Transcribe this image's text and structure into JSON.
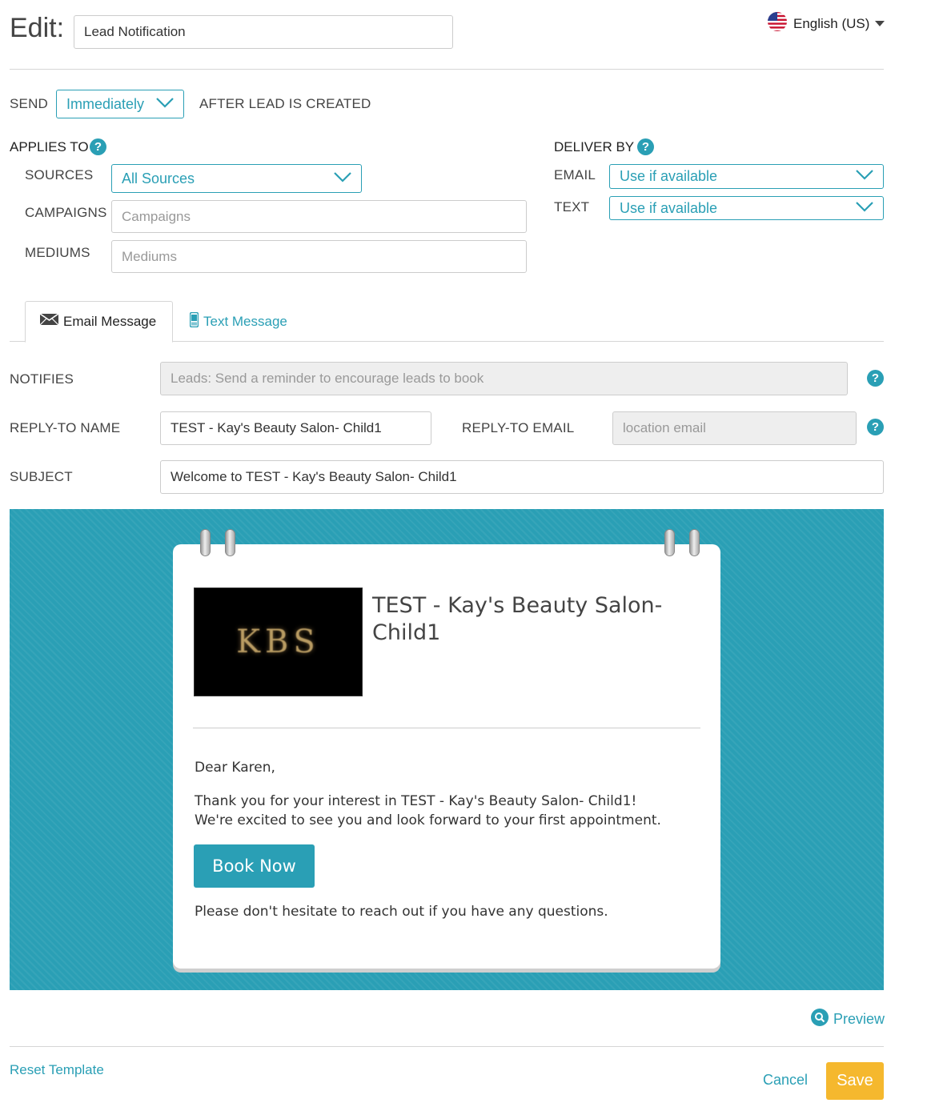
{
  "header": {
    "edit_label": "Edit:",
    "name_value": "Lead Notification",
    "language": "English (US)"
  },
  "send": {
    "label": "SEND",
    "timing": "Immediately",
    "suffix": "AFTER LEAD IS CREATED"
  },
  "applies_to": {
    "label": "APPLIES TO",
    "sources_label": "SOURCES",
    "sources_value": "All Sources",
    "campaigns_label": "CAMPAIGNS",
    "campaigns_placeholder": "Campaigns",
    "mediums_label": "MEDIUMS",
    "mediums_placeholder": "Mediums"
  },
  "deliver_by": {
    "label": "DELIVER BY",
    "email_label": "EMAIL",
    "email_value": "Use if available",
    "text_label": "TEXT",
    "text_value": "Use if available"
  },
  "tabs": [
    {
      "label": "Email Message",
      "active": true
    },
    {
      "label": "Text Message",
      "active": false
    }
  ],
  "form": {
    "notifies_label": "NOTIFIES",
    "notifies_value": "Leads: Send a reminder to encourage leads to book",
    "reply_name_label": "REPLY-TO NAME",
    "reply_name_value": "TEST - Kay's Beauty Salon- Child1",
    "reply_email_label": "REPLY-TO EMAIL",
    "reply_email_placeholder": "location email",
    "subject_label": "SUBJECT",
    "subject_value": "Welcome to TEST - Kay's Beauty Salon- Child1"
  },
  "email_preview": {
    "business_name": "TEST - Kay's Beauty Salon- Child1",
    "logo_text": "KBS",
    "greeting": "Dear Karen,",
    "body_line1": "Thank you for your interest in TEST - Kay's Beauty Salon- Child1!",
    "body_line2": "We're excited to see you and look forward to your first appointment.",
    "cta_label": "Book Now",
    "closing": "Please don't hesitate to reach out if you have any questions."
  },
  "footer": {
    "preview_label": "Preview",
    "reset_label": "Reset Template",
    "cancel_label": "Cancel",
    "save_label": "Save"
  },
  "colors": {
    "accent": "#2a9fb5",
    "save": "#f5b82e"
  }
}
